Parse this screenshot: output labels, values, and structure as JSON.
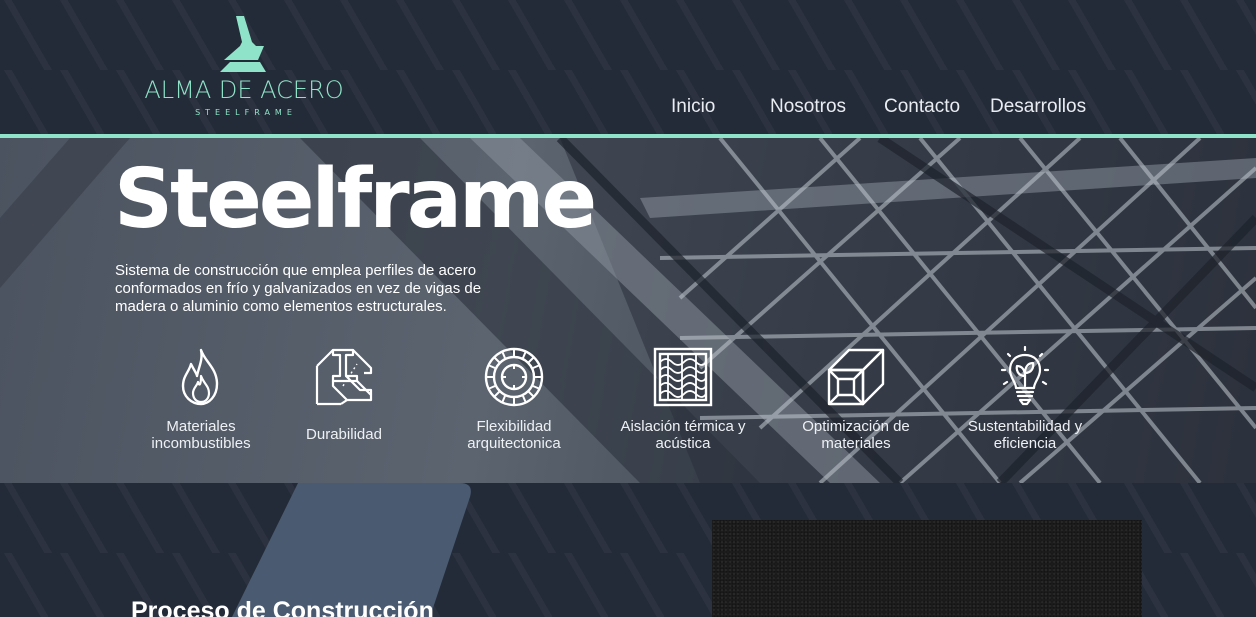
{
  "brand": {
    "name": "ALMA DE ACERO",
    "tagline": "STEELFRAME",
    "logo_icon": "logo-a-icon",
    "accent_color": "#8fe3c8"
  },
  "nav": {
    "items": [
      {
        "label": "Inicio"
      },
      {
        "label": "Nosotros"
      },
      {
        "label": "Contacto"
      },
      {
        "label": "Desarrollos"
      }
    ]
  },
  "hero": {
    "title": "Steelframe",
    "description": "Sistema de construcción que emplea perfiles de acero conformados en frío y galvanizados en vez de vigas de madera o aluminio como elementos estructurales.",
    "features": [
      {
        "icon": "flame-icon",
        "label": "Materiales incombustibles"
      },
      {
        "icon": "steel-beam-icon",
        "label": "Durabilidad"
      },
      {
        "icon": "ring-icon",
        "label": "Flexibilidad arquitectonica"
      },
      {
        "icon": "insulation-panel-icon",
        "label": "Aislación térmica y acústica"
      },
      {
        "icon": "steel-profile-icon",
        "label": "Optimización de materiales"
      },
      {
        "icon": "eco-bulb-icon",
        "label": "Sustentabilidad y eficiencia"
      }
    ]
  },
  "section": {
    "title": "Proceso de Construcción"
  },
  "colors": {
    "background": "#242b38",
    "panel": "#4a5a70"
  }
}
